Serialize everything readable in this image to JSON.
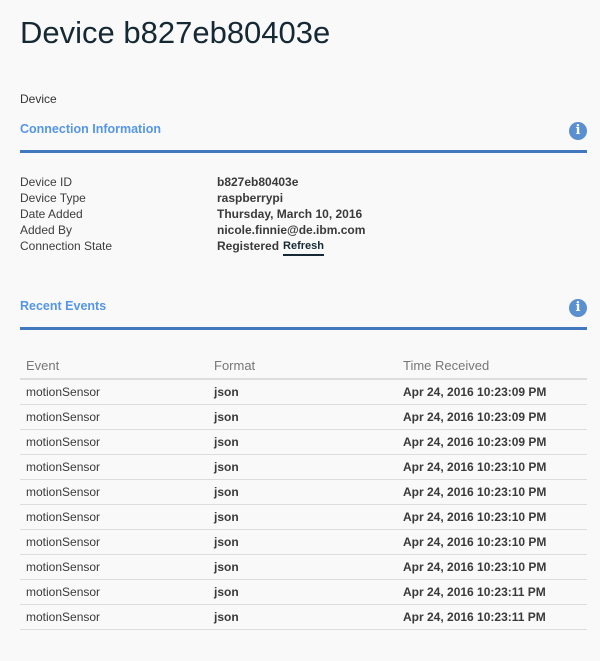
{
  "title": "Device b827eb80403e",
  "breadcrumb": "Device",
  "connection": {
    "heading": "Connection Information",
    "fields": [
      {
        "label": "Device ID",
        "value": "b827eb80403e"
      },
      {
        "label": "Device Type",
        "value": "raspberrypi"
      },
      {
        "label": "Date Added",
        "value": "Thursday, March 10, 2016"
      },
      {
        "label": "Added By",
        "value": "nicole.finnie@de.ibm.com"
      },
      {
        "label": "Connection State",
        "value": "Registered"
      }
    ],
    "refresh_label": "Refresh"
  },
  "events": {
    "heading": "Recent Events",
    "columns": [
      "Event",
      "Format",
      "Time Received"
    ],
    "rows": [
      {
        "event": "motionSensor",
        "format": "json",
        "time": "Apr 24, 2016 10:23:09 PM"
      },
      {
        "event": "motionSensor",
        "format": "json",
        "time": "Apr 24, 2016 10:23:09 PM"
      },
      {
        "event": "motionSensor",
        "format": "json",
        "time": "Apr 24, 2016 10:23:09 PM"
      },
      {
        "event": "motionSensor",
        "format": "json",
        "time": "Apr 24, 2016 10:23:10 PM"
      },
      {
        "event": "motionSensor",
        "format": "json",
        "time": "Apr 24, 2016 10:23:10 PM"
      },
      {
        "event": "motionSensor",
        "format": "json",
        "time": "Apr 24, 2016 10:23:10 PM"
      },
      {
        "event": "motionSensor",
        "format": "json",
        "time": "Apr 24, 2016 10:23:10 PM"
      },
      {
        "event": "motionSensor",
        "format": "json",
        "time": "Apr 24, 2016 10:23:10 PM"
      },
      {
        "event": "motionSensor",
        "format": "json",
        "time": "Apr 24, 2016 10:23:11 PM"
      },
      {
        "event": "motionSensor",
        "format": "json",
        "time": "Apr 24, 2016 10:23:11 PM"
      }
    ]
  }
}
